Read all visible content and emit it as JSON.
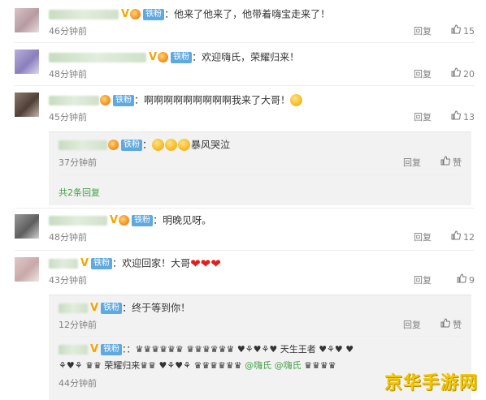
{
  "badge_label": "铁粉",
  "vip_mark": "V",
  "reply_label": "回复",
  "like_label": "赞",
  "colors": {
    "fan_badge": "#5fa9e1",
    "link_green": "#43a047",
    "vip_gold": "#f2a600",
    "meta_gray": "#808080"
  },
  "comments": [
    {
      "text": "：他来了他来了，他带着嗨宝走来了！",
      "time": "46分钟前",
      "likes": "15"
    },
    {
      "text": "：欢迎嗨氏，荣耀归来！",
      "time": "48分钟前",
      "likes": "20"
    },
    {
      "text": "：啊啊啊啊啊啊啊啊啊我来了大哥！",
      "time": "45分钟前",
      "likes": "13",
      "replies": [
        {
          "text": "暴风哭泣",
          "prefix": "：",
          "time": "37分钟前"
        }
      ],
      "more_replies": "共2条回复"
    },
    {
      "text": "：明晚见呀。",
      "time": "48分钟前",
      "likes": "12"
    },
    {
      "text": "：欢迎回家！大哥",
      "time": "43分钟前",
      "likes": "9",
      "replies": [
        {
          "text": "：终于等到你！",
          "time": "12分钟前"
        },
        {
          "text_line1": "：：♛♛♛♛♛♛ ♛♛♛♛♛♛ ♥⚘♥⚘♥  天生王者  ♥⚘♥ ♥",
          "text_line2_a": "⚘♥⚘  ♛♛ 荣耀归来♛♛  ♥⚘♥⚘  ♛♛♛♛♛♛  ",
          "mention1": "@嗨氏",
          "mention2": "@嗨氏",
          "text_line2_b": "  ♛♛♛♛",
          "time": "44分钟前"
        }
      ]
    }
  ],
  "watermark": "京华手游网"
}
